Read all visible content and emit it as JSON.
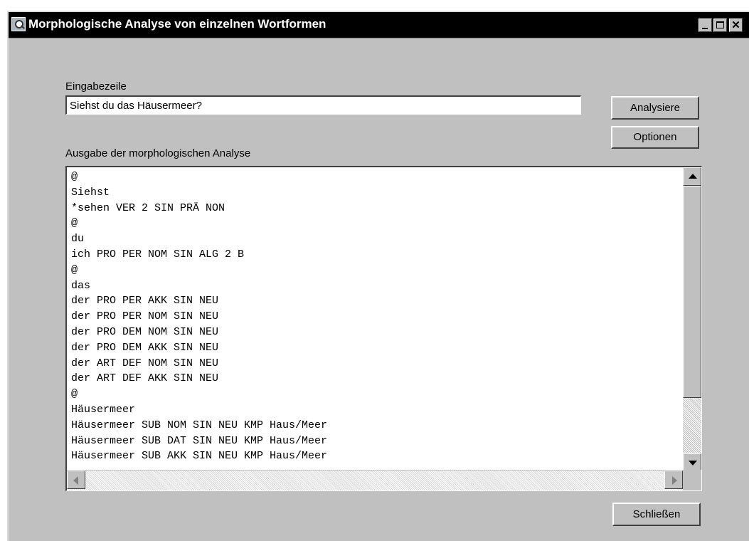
{
  "window": {
    "title": "Morphologische Analyse von einzelnen Wortformen",
    "controls": {
      "minimize": "minimize",
      "maximize": "maximize",
      "close": "✕"
    }
  },
  "input_section": {
    "label": "Eingabezeile",
    "value": "Siehst du das Häusermeer?"
  },
  "buttons": {
    "analyse": "Analysiere",
    "options": "Optionen",
    "close": "Schließen"
  },
  "output_section": {
    "label": "Ausgabe der morphologischen Analyse",
    "lines": [
      "@",
      "Siehst",
      "*sehen VER 2 SIN PRÄ NON",
      "@",
      "du",
      "ich PRO PER NOM SIN ALG 2 B",
      "@",
      "das",
      "der PRO PER AKK SIN NEU",
      "der PRO PER NOM SIN NEU",
      "der PRO DEM NOM SIN NEU",
      "der PRO DEM AKK SIN NEU",
      "der ART DEF NOM SIN NEU",
      "der ART DEF AKK SIN NEU",
      "@",
      "Häusermeer",
      "Häusermeer SUB NOM SIN NEU KMP Haus/Meer",
      "Häusermeer SUB DAT SIN NEU KMP Haus/Meer",
      "Häusermeer SUB AKK SIN NEU KMP Haus/Meer"
    ]
  }
}
